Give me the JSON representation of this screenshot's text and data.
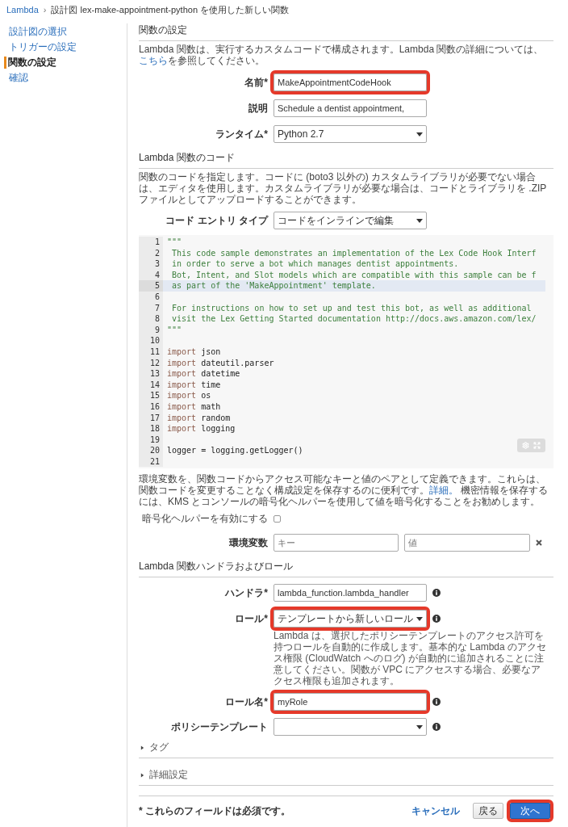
{
  "breadcrumb": {
    "root": "Lambda",
    "separator": "›",
    "current": "設計図 lex-make-appointment-python を使用した新しい関数"
  },
  "sidebar": {
    "items": [
      {
        "label": "設計図の選択",
        "selected": false
      },
      {
        "label": "トリガーの設定",
        "selected": false
      },
      {
        "label": "関数の設定",
        "selected": true
      },
      {
        "label": "確認",
        "selected": false
      }
    ]
  },
  "function_settings": {
    "title": "関数の設定",
    "description_before": "Lambda 関数は、実行するカスタムコードで構成されます。Lambda 関数の詳細については、",
    "link": "こちら",
    "description_after": "を参照してください。",
    "fields": [
      {
        "kind": "text",
        "label": "名前*",
        "value": "MakeAppointmentCodeHook",
        "highlighted": true
      },
      {
        "kind": "text",
        "label": "説明",
        "value": "Schedule a dentist appointment,",
        "highlighted": false
      },
      {
        "kind": "select",
        "label": "ランタイム*",
        "value": "Python 2.7",
        "highlighted": false
      }
    ]
  },
  "code_section": {
    "title": "Lambda 関数のコード",
    "description": "関数のコードを指定します。コードに (boto3 以外の) カスタムライブラリが必要でない場合は、エディタを使用します。カスタムライブラリが必要な場合は、コードとライブラリを .ZIP ファイルとしてアップロードすることができます。",
    "entry_type": {
      "kind": "select",
      "label": "コード エントリ タイプ",
      "value": "コードをインラインで編集",
      "highlighted": false
    },
    "lines": [
      {
        "number": "1",
        "kind": "comment",
        "text": "\"\"\"",
        "active": false
      },
      {
        "number": "2",
        "kind": "comment",
        "text": " This code sample demonstrates an implementation of the Lex Code Hook Interf",
        "active": false
      },
      {
        "number": "3",
        "kind": "comment",
        "text": " in order to serve a bot which manages dentist appointments.",
        "active": false
      },
      {
        "number": "4",
        "kind": "comment",
        "text": " Bot, Intent, and Slot models which are compatible with this sample can be f",
        "active": false
      },
      {
        "number": "5",
        "kind": "comment",
        "text": " as part of the 'MakeAppointment' template.",
        "active": true
      },
      {
        "number": "6",
        "kind": "blank",
        "active": false
      },
      {
        "number": "7",
        "kind": "comment",
        "text": " For instructions on how to set up and test this bot, as well as additional",
        "active": false
      },
      {
        "number": "8",
        "kind": "comment",
        "text": " visit the Lex Getting Started documentation http://docs.aws.amazon.com/lex/",
        "active": false
      },
      {
        "number": "9",
        "kind": "comment",
        "text": "\"\"\"",
        "active": false
      },
      {
        "number": "10",
        "kind": "blank",
        "active": false
      },
      {
        "number": "11",
        "kind": "import",
        "keyword": "import",
        "text": " json",
        "active": false
      },
      {
        "number": "12",
        "kind": "import",
        "keyword": "import",
        "text": " dateutil.parser",
        "active": false
      },
      {
        "number": "13",
        "kind": "import",
        "keyword": "import",
        "text": " datetime",
        "active": false
      },
      {
        "number": "14",
        "kind": "import",
        "keyword": "import",
        "text": " time",
        "active": false
      },
      {
        "number": "15",
        "kind": "import",
        "keyword": "import",
        "text": " os",
        "active": false
      },
      {
        "number": "16",
        "kind": "import",
        "keyword": "import",
        "text": " math",
        "active": false
      },
      {
        "number": "17",
        "kind": "import",
        "keyword": "import",
        "text": " random",
        "active": false
      },
      {
        "number": "18",
        "kind": "import",
        "keyword": "import",
        "text": " logging",
        "active": false
      },
      {
        "number": "19",
        "kind": "blank",
        "active": false
      },
      {
        "number": "20",
        "kind": "code",
        "text": "logger = logging.getLogger()",
        "active": false
      },
      {
        "number": "21",
        "kind": "blank",
        "active": false
      }
    ]
  },
  "env_section": {
    "description_before": "環境変数を、関数コードからアクセス可能なキーと値のペアとして定義できます。これらは、関数コードを変更することなく構成設定を保存するのに便利です。",
    "link": "詳細。",
    "description_after": " 機密情報を保存するには、KMS とコンソールの暗号化ヘルパーを使用して値を暗号化することをお勧めします。",
    "encryption": {
      "label": "暗号化ヘルパーを有効にする",
      "checked": false
    },
    "variables": {
      "label": "環境変数",
      "key_placeholder": "キー",
      "value_placeholder": "値"
    }
  },
  "handler_section": {
    "title": "Lambda 関数ハンドラおよびロール",
    "fields": [
      {
        "kind": "text",
        "label": "ハンドラ*",
        "value": "lambda_function.lambda_handler",
        "highlighted": false
      },
      {
        "kind": "select",
        "label": "ロール*",
        "value": "テンプレートから新しいロール",
        "highlighted": true,
        "help": "Lambda は、選択したポリシーテンプレートのアクセス許可を持つロールを自動的に作成します。基本的な Lambda のアクセス権限 (CloudWatch へのログ) が自動的に追加されることに注意してください。関数が VPC にアクセスする場合、必要なアクセス権限も追加されます。"
      },
      {
        "kind": "text",
        "label": "ロール名*",
        "value": "myRole",
        "highlighted": true
      },
      {
        "kind": "select",
        "label": "ポリシーテンプレート",
        "highlighted": false
      }
    ]
  },
  "collapsibles": [
    {
      "label": "タグ",
      "expanded": false
    },
    {
      "label": "詳細設定",
      "expanded": false
    }
  ],
  "footer": {
    "note": "* これらのフィールドは必須です。",
    "cancel": "キャンセル",
    "back": "戻る",
    "next": {
      "label": "次へ",
      "highlighted": true
    }
  }
}
